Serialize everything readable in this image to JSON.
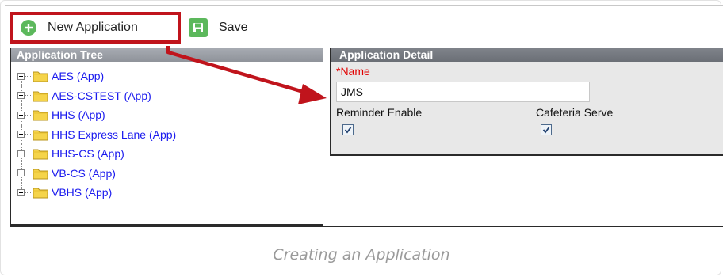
{
  "toolbar": {
    "new_application_label": "New Application",
    "save_label": "Save"
  },
  "tree": {
    "title": "Application Tree",
    "items": [
      {
        "label": "AES (App)"
      },
      {
        "label": "AES-CSTEST (App)"
      },
      {
        "label": "HHS (App)"
      },
      {
        "label": "HHS Express Lane (App)"
      },
      {
        "label": "HHS-CS (App)"
      },
      {
        "label": "VB-CS (App)"
      },
      {
        "label": "VBHS (App)"
      }
    ]
  },
  "detail": {
    "title": "Application Detail",
    "name_label": "*Name",
    "name_value": "JMS",
    "reminder_label": "Reminder Enable",
    "reminder_checked": true,
    "cafeteria_label": "Cafeteria Serve",
    "cafeteria_checked": true
  },
  "caption": "Creating an Application",
  "colors": {
    "accent_green": "#5cb85c",
    "highlight_red": "#c0141c",
    "link_blue": "#1a1aee",
    "required_red": "#e10000"
  },
  "icons": {
    "new": "plus-circle-icon",
    "save": "floppy-disk-icon",
    "folder": "folder-icon",
    "expander": "plus-box-icon"
  }
}
